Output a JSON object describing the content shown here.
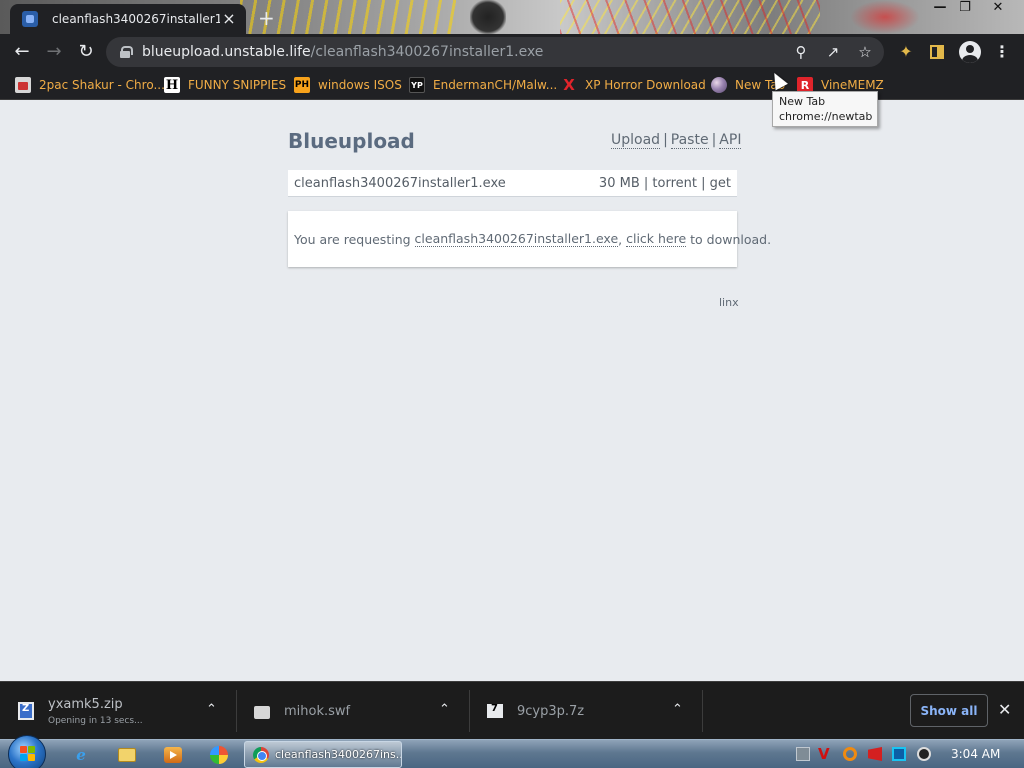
{
  "browser": {
    "tab_title": "cleanflash3400267installer1.exe",
    "tab_close_glyph": "×",
    "new_tab_glyph": "+",
    "window_controls": {
      "minimize": "—",
      "maximize": "❐",
      "close": "✕"
    },
    "url_host": "blueupload.unstable.life",
    "url_path": "/cleanflash3400267installer1.exe",
    "nav_icons": {
      "back": "back-arrow-icon",
      "forward": "forward-arrow-icon",
      "reload": "reload-icon"
    }
  },
  "bookmarks": [
    {
      "label": "2pac Shakur - Chro...",
      "icon": "2pac-icon"
    },
    {
      "label": "FUNNY SNIPPIES",
      "icon": "h-icon",
      "glyph": "H"
    },
    {
      "label": "windows ISOS",
      "icon": "ph-icon",
      "glyph": "PH"
    },
    {
      "label": "EndermanCH/Malw...",
      "icon": "yp-icon",
      "glyph": "YP"
    },
    {
      "label": "XP Horror Download",
      "icon": "x-icon",
      "glyph": "X"
    },
    {
      "label": "New Tab",
      "icon": "globe-icon"
    },
    {
      "label": "VineMEMZ",
      "icon": "r-icon",
      "glyph": "R"
    }
  ],
  "tooltip": {
    "title": "New Tab",
    "url": "chrome://newtab"
  },
  "page": {
    "brand": "Blueupload",
    "links": {
      "upload": "Upload",
      "paste": "Paste",
      "api": "API",
      "separator": "|"
    },
    "file": {
      "name": "cleanflash3400267installer1.exe",
      "size": "30 MB",
      "torrent": "torrent",
      "get": "get",
      "separator": "|"
    },
    "notice": {
      "prefix": "You are requesting ",
      "file_link": "cleanflash3400267installer1.exe",
      "comma": ", ",
      "action_link": "click here",
      "suffix": " to download."
    },
    "footer": "linx"
  },
  "downloads": [
    {
      "name": "yxamk5.zip",
      "status": "Opening in 13 secs...",
      "icon": "zip-icon"
    },
    {
      "name": "mihok.swf",
      "status": "",
      "icon": "swf-icon"
    },
    {
      "name": "9cyp3p.7z",
      "status": "",
      "icon": "7z-icon"
    }
  ],
  "downloads_shelf": {
    "show_all": "Show all",
    "close_glyph": "✕",
    "caret_glyph": "⌃"
  },
  "taskbar": {
    "active_window": "cleanflash3400267ins...",
    "clock": "3:04 AM",
    "ie_glyph": "e"
  },
  "colors": {
    "bookmark_text": "#f1ad46",
    "page_background": "#e8ebef",
    "brand_text": "#5b6b80",
    "link_blue": "#8ab4f8"
  }
}
